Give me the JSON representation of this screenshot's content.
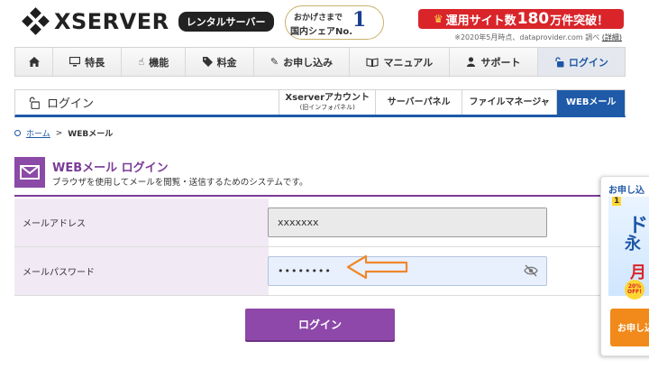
{
  "header": {
    "logo_text": "XSERVER",
    "rental_badge": "レンタルサーバー",
    "award_line1": "おかげさまで",
    "award_line2": "国内シェアNo.",
    "award_no1": "1",
    "promo_prefix": "運用サイト数",
    "promo_number": "180",
    "promo_suffix": "万件突破！",
    "promo_note": "※2020年5月時点、dataprovider.com 調べ",
    "promo_note_link": "(詳細)"
  },
  "global_nav": {
    "items": [
      {
        "label": "",
        "icon": "home-icon"
      },
      {
        "label": "特長",
        "icon": "monitor-icon"
      },
      {
        "label": "機能",
        "icon": "pointer-icon"
      },
      {
        "label": "料金",
        "icon": "tag-icon"
      },
      {
        "label": "お申し込み",
        "icon": "pencil-icon"
      },
      {
        "label": "マニュアル",
        "icon": "book-icon"
      },
      {
        "label": "サポート",
        "icon": "person-icon"
      },
      {
        "label": "ログイン",
        "icon": "unlock-icon"
      }
    ]
  },
  "sub_nav": {
    "title": "ログイン",
    "tabs": [
      {
        "label": "Xserverアカウント",
        "sub": "(旧インフォパネル)"
      },
      {
        "label": "サーバーパネル"
      },
      {
        "label": "ファイルマネージャ"
      },
      {
        "label": "WEBメール"
      }
    ]
  },
  "breadcrumb": {
    "home": "ホーム",
    "separator": ">",
    "current": "WEBメール"
  },
  "heading": {
    "title": "WEBメール ログイン",
    "subtitle": "ブラウザを使用してメールを閲覧・送信するためのシステムです。"
  },
  "form": {
    "email_label": "メールアドレス",
    "email_value": "xxxxxxx",
    "password_label": "メールパスワード",
    "password_value": "••••••••",
    "submit_label": "ログイン"
  },
  "side_ad": {
    "head": "お申し込",
    "num": "1",
    "big1": "ド",
    "big2": "永",
    "month": "月",
    "off_line1": "20%",
    "off_line2": "OFF!",
    "button": "お申し込"
  },
  "colors": {
    "brand_blue": "#1e5aa8",
    "accent_purple": "#8e48a9",
    "promo_red": "#d9252a",
    "annotation_arrow": "#f0882b"
  }
}
